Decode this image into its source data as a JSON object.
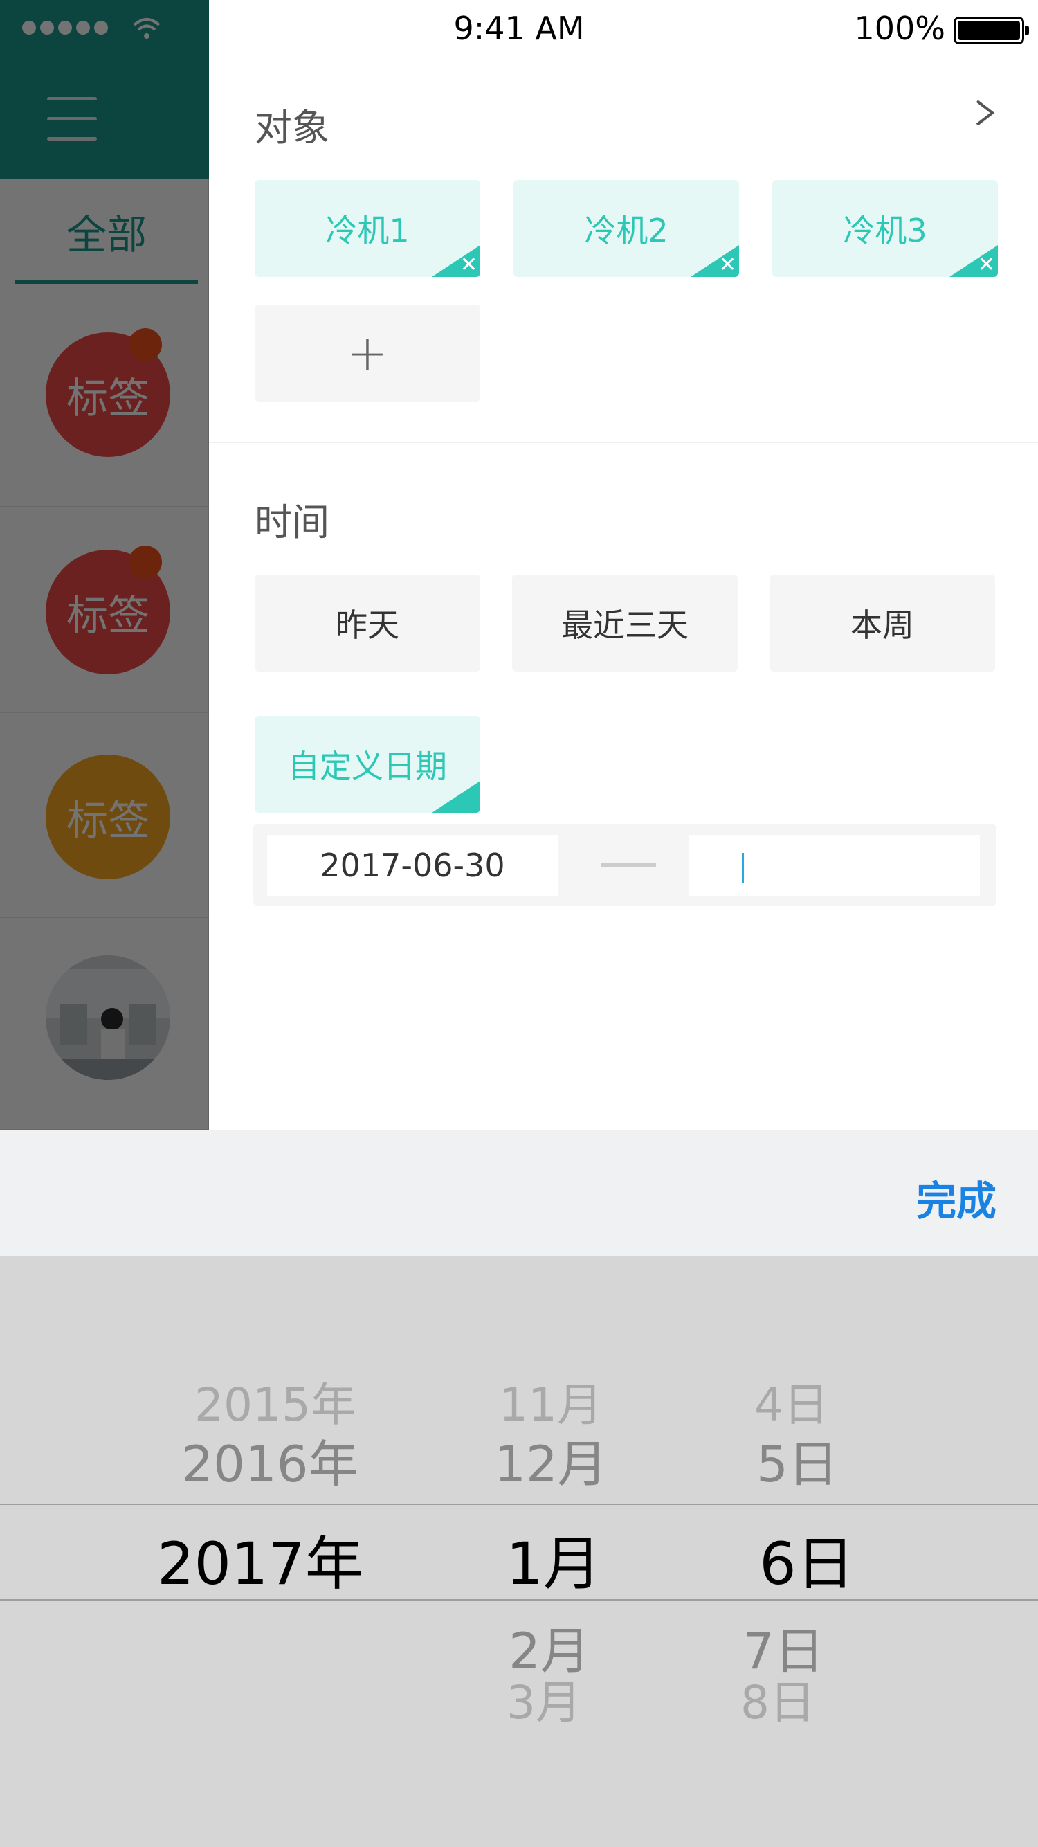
{
  "status_bar": {
    "time": "9:41 AM",
    "battery_percent": "100%"
  },
  "sidebar": {
    "tab_all": "全部",
    "items": [
      {
        "label": "标签",
        "color": "red",
        "badge": true
      },
      {
        "label": "标签",
        "color": "red",
        "badge": true
      },
      {
        "label": "标签",
        "color": "orange",
        "badge": false
      },
      {
        "type": "avatar"
      }
    ]
  },
  "filter": {
    "object_title": "对象",
    "objects": [
      "冷机1",
      "冷机2",
      "冷机3"
    ],
    "add_label": "+",
    "time_title": "时间",
    "time_options": [
      "昨天",
      "最近三天",
      "本周"
    ],
    "custom_date_label": "自定义日期",
    "start_date": "2017-06-30",
    "end_date": ""
  },
  "picker": {
    "done_label": "完成",
    "years": {
      "far_above": "2015年",
      "above": "2016年",
      "selected": "2017年"
    },
    "months": {
      "far_above": "11月",
      "above": "12月",
      "selected": "1月",
      "below": "2月",
      "far_below": "3月"
    },
    "days": {
      "far_above": "4日",
      "above": "5日",
      "selected": "6日",
      "below": "7日",
      "far_below": "8日"
    }
  },
  "colors": {
    "accent_teal": "#2cc8b5",
    "sidebar_teal": "#1c9a8f",
    "done_blue": "#1a82e2"
  }
}
